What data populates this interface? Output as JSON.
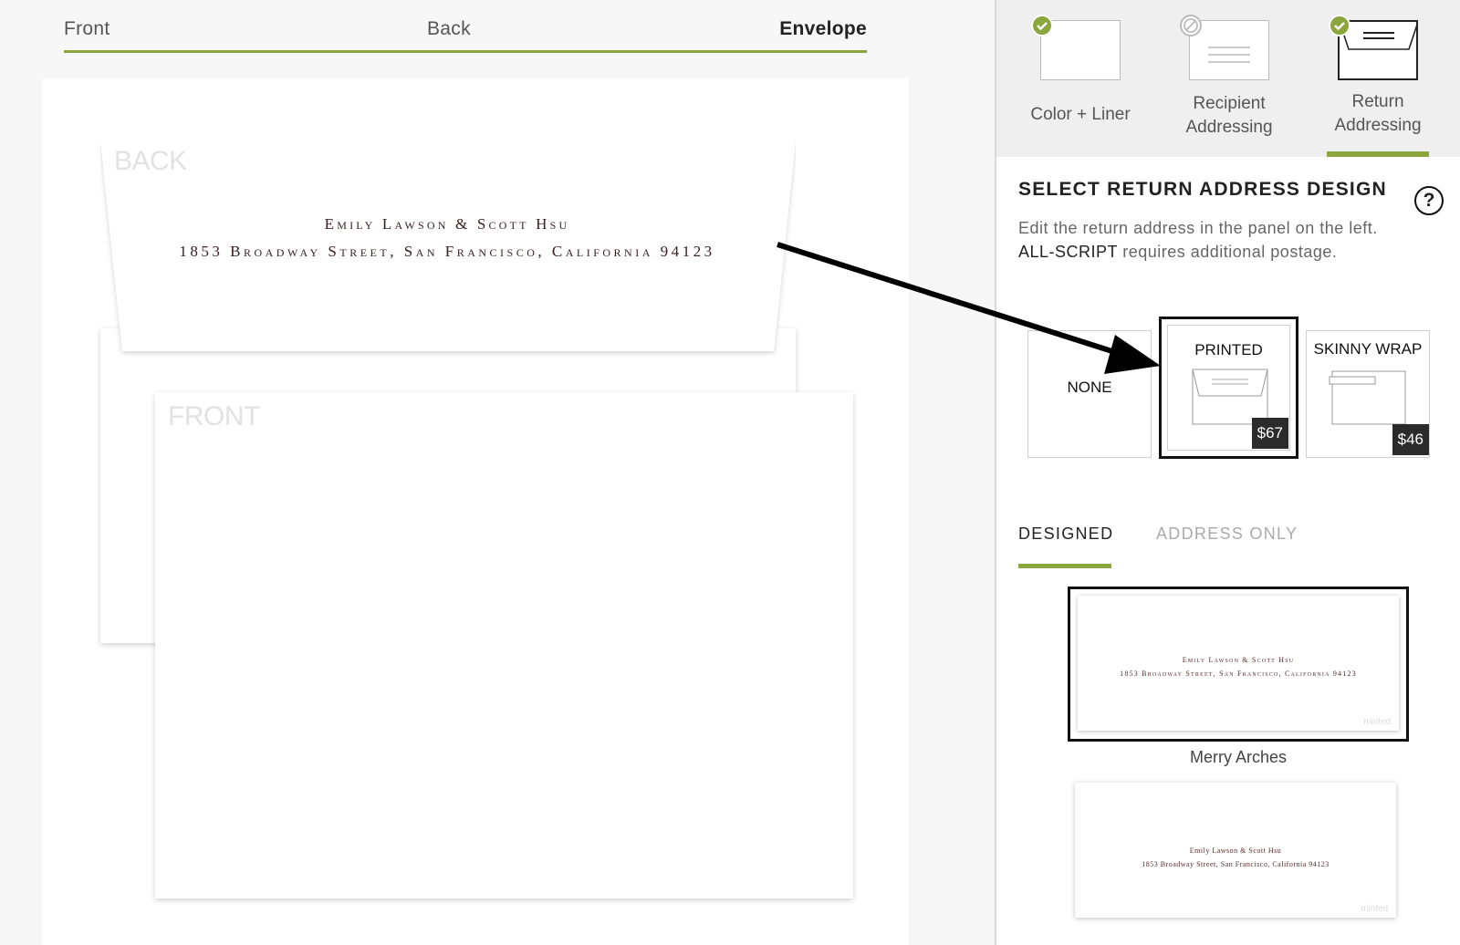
{
  "view_tabs": {
    "front": "Front",
    "back": "Back",
    "envelope": "Envelope"
  },
  "envelope_preview": {
    "back_label": "BACK",
    "front_label": "FRONT",
    "return_name": "Emily Lawson & Scott Hsu",
    "return_street": "1853 Broadway Street, San Francisco, California 94123"
  },
  "steps": [
    {
      "label_line1": "Color + Liner",
      "label_line2": "",
      "status": "complete"
    },
    {
      "label_line1": "Recipient",
      "label_line2": "Addressing",
      "status": "disabled"
    },
    {
      "label_line1": "Return",
      "label_line2": "Addressing",
      "status": "complete"
    }
  ],
  "panel": {
    "title": "SELECT RETURN ADDRESS DESIGN",
    "help_icon": "?",
    "desc_before": "Edit the return address in the panel on the left. ",
    "desc_bold": "ALL-SCRIPT",
    "desc_after": " requires additional postage."
  },
  "options": [
    {
      "title": "NONE"
    },
    {
      "title": "PRINTED",
      "price": "$67"
    },
    {
      "title": "SKINNY WRAP",
      "price": "$46"
    }
  ],
  "sub_tabs": {
    "designed": "DESIGNED",
    "address_only": "ADDRESS ONLY"
  },
  "designs": [
    {
      "name": "Merry Arches",
      "line1": "Emily Lawson & Scott Hsu",
      "line2": "1853 Broadway Street, San Francisco, California 94123",
      "watermark": "minted."
    },
    {
      "line1": "Emily Lawson & Scott Hsu",
      "line2": "1853 Broadway Street, San Francisco, California 94123",
      "watermark": "minted."
    }
  ],
  "colors": {
    "accent": "#8aa63c",
    "price_badge": "#2b2b2b"
  }
}
